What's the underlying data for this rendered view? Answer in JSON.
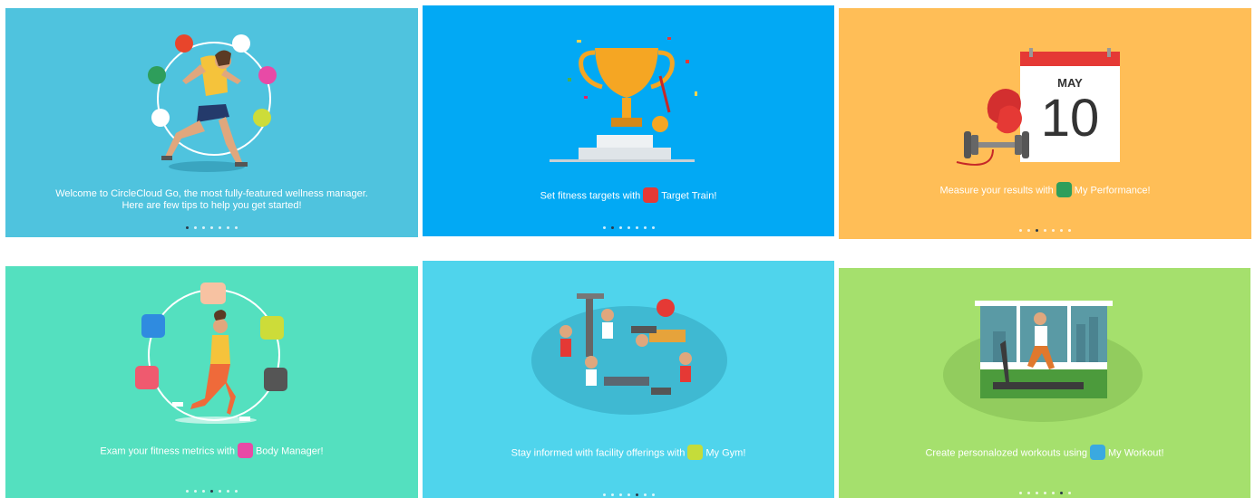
{
  "cards": [
    {
      "id": "welcome",
      "bg": "#4fc3de",
      "caption_lines": [
        "Welcome to CircleCloud Go, the most fully-featured wellness manager.",
        "Here are few tips to help you get started!"
      ],
      "dots_total": 7,
      "active_dot": 1
    },
    {
      "id": "target-train",
      "bg": "#02a9f4",
      "caption_prefix": "Set fitness targets with",
      "feature_name": "Target Train!",
      "icon": "target-train-icon",
      "icon_color": "#e53935",
      "dots_total": 7,
      "active_dot": 2
    },
    {
      "id": "my-performance",
      "bg": "#ffbe57",
      "caption_prefix": "Measure your results with",
      "feature_name": "My Performance!",
      "icon": "performance-icon",
      "icon_color": "#2e9e5b",
      "calendar_month": "MAY",
      "calendar_day": "10",
      "dots_total": 7,
      "active_dot": 3
    },
    {
      "id": "body-manager",
      "bg": "#54e0bf",
      "caption_prefix": "Exam your fitness metrics with",
      "feature_name": "Body Manager!",
      "icon": "body-manager-icon",
      "icon_color": "#e84aa6",
      "dots_total": 7,
      "active_dot": 4
    },
    {
      "id": "my-gym",
      "bg": "#4fd4ec",
      "caption_prefix": "Stay informed with facility offerings with",
      "feature_name": "My Gym!",
      "icon": "gym-icon",
      "icon_color": "#c5dc3a",
      "dots_total": 7,
      "active_dot": 5
    },
    {
      "id": "my-workout",
      "bg": "#a5e06d",
      "caption_prefix": "Create personalozed workouts using",
      "feature_name": "My Workout!",
      "icon": "workout-icon",
      "icon_color": "#3aa9e0",
      "dots_total": 7,
      "active_dot": 6
    }
  ]
}
